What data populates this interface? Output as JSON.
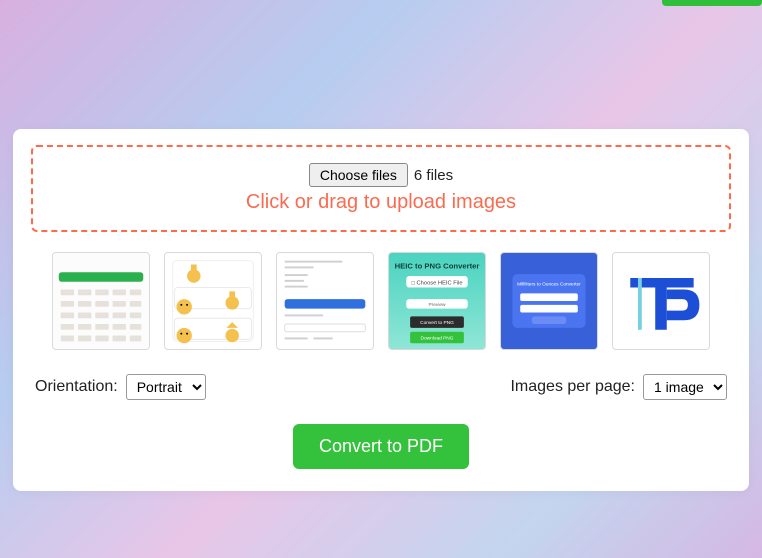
{
  "dropzone": {
    "choose_label": "Choose files",
    "file_count_text": "6 files",
    "drag_label": "Click or drag to upload images"
  },
  "thumbnails": [
    {
      "alt": "thumb-1"
    },
    {
      "alt": "thumb-2"
    },
    {
      "alt": "thumb-3"
    },
    {
      "alt": "thumb-4"
    },
    {
      "alt": "thumb-5"
    },
    {
      "alt": "thumb-6"
    }
  ],
  "controls": {
    "orientation_label": "Orientation:",
    "orientation_value": "Portrait",
    "per_page_label": "Images per page:",
    "per_page_value": "1 image"
  },
  "actions": {
    "convert_label": "Convert to PDF"
  }
}
